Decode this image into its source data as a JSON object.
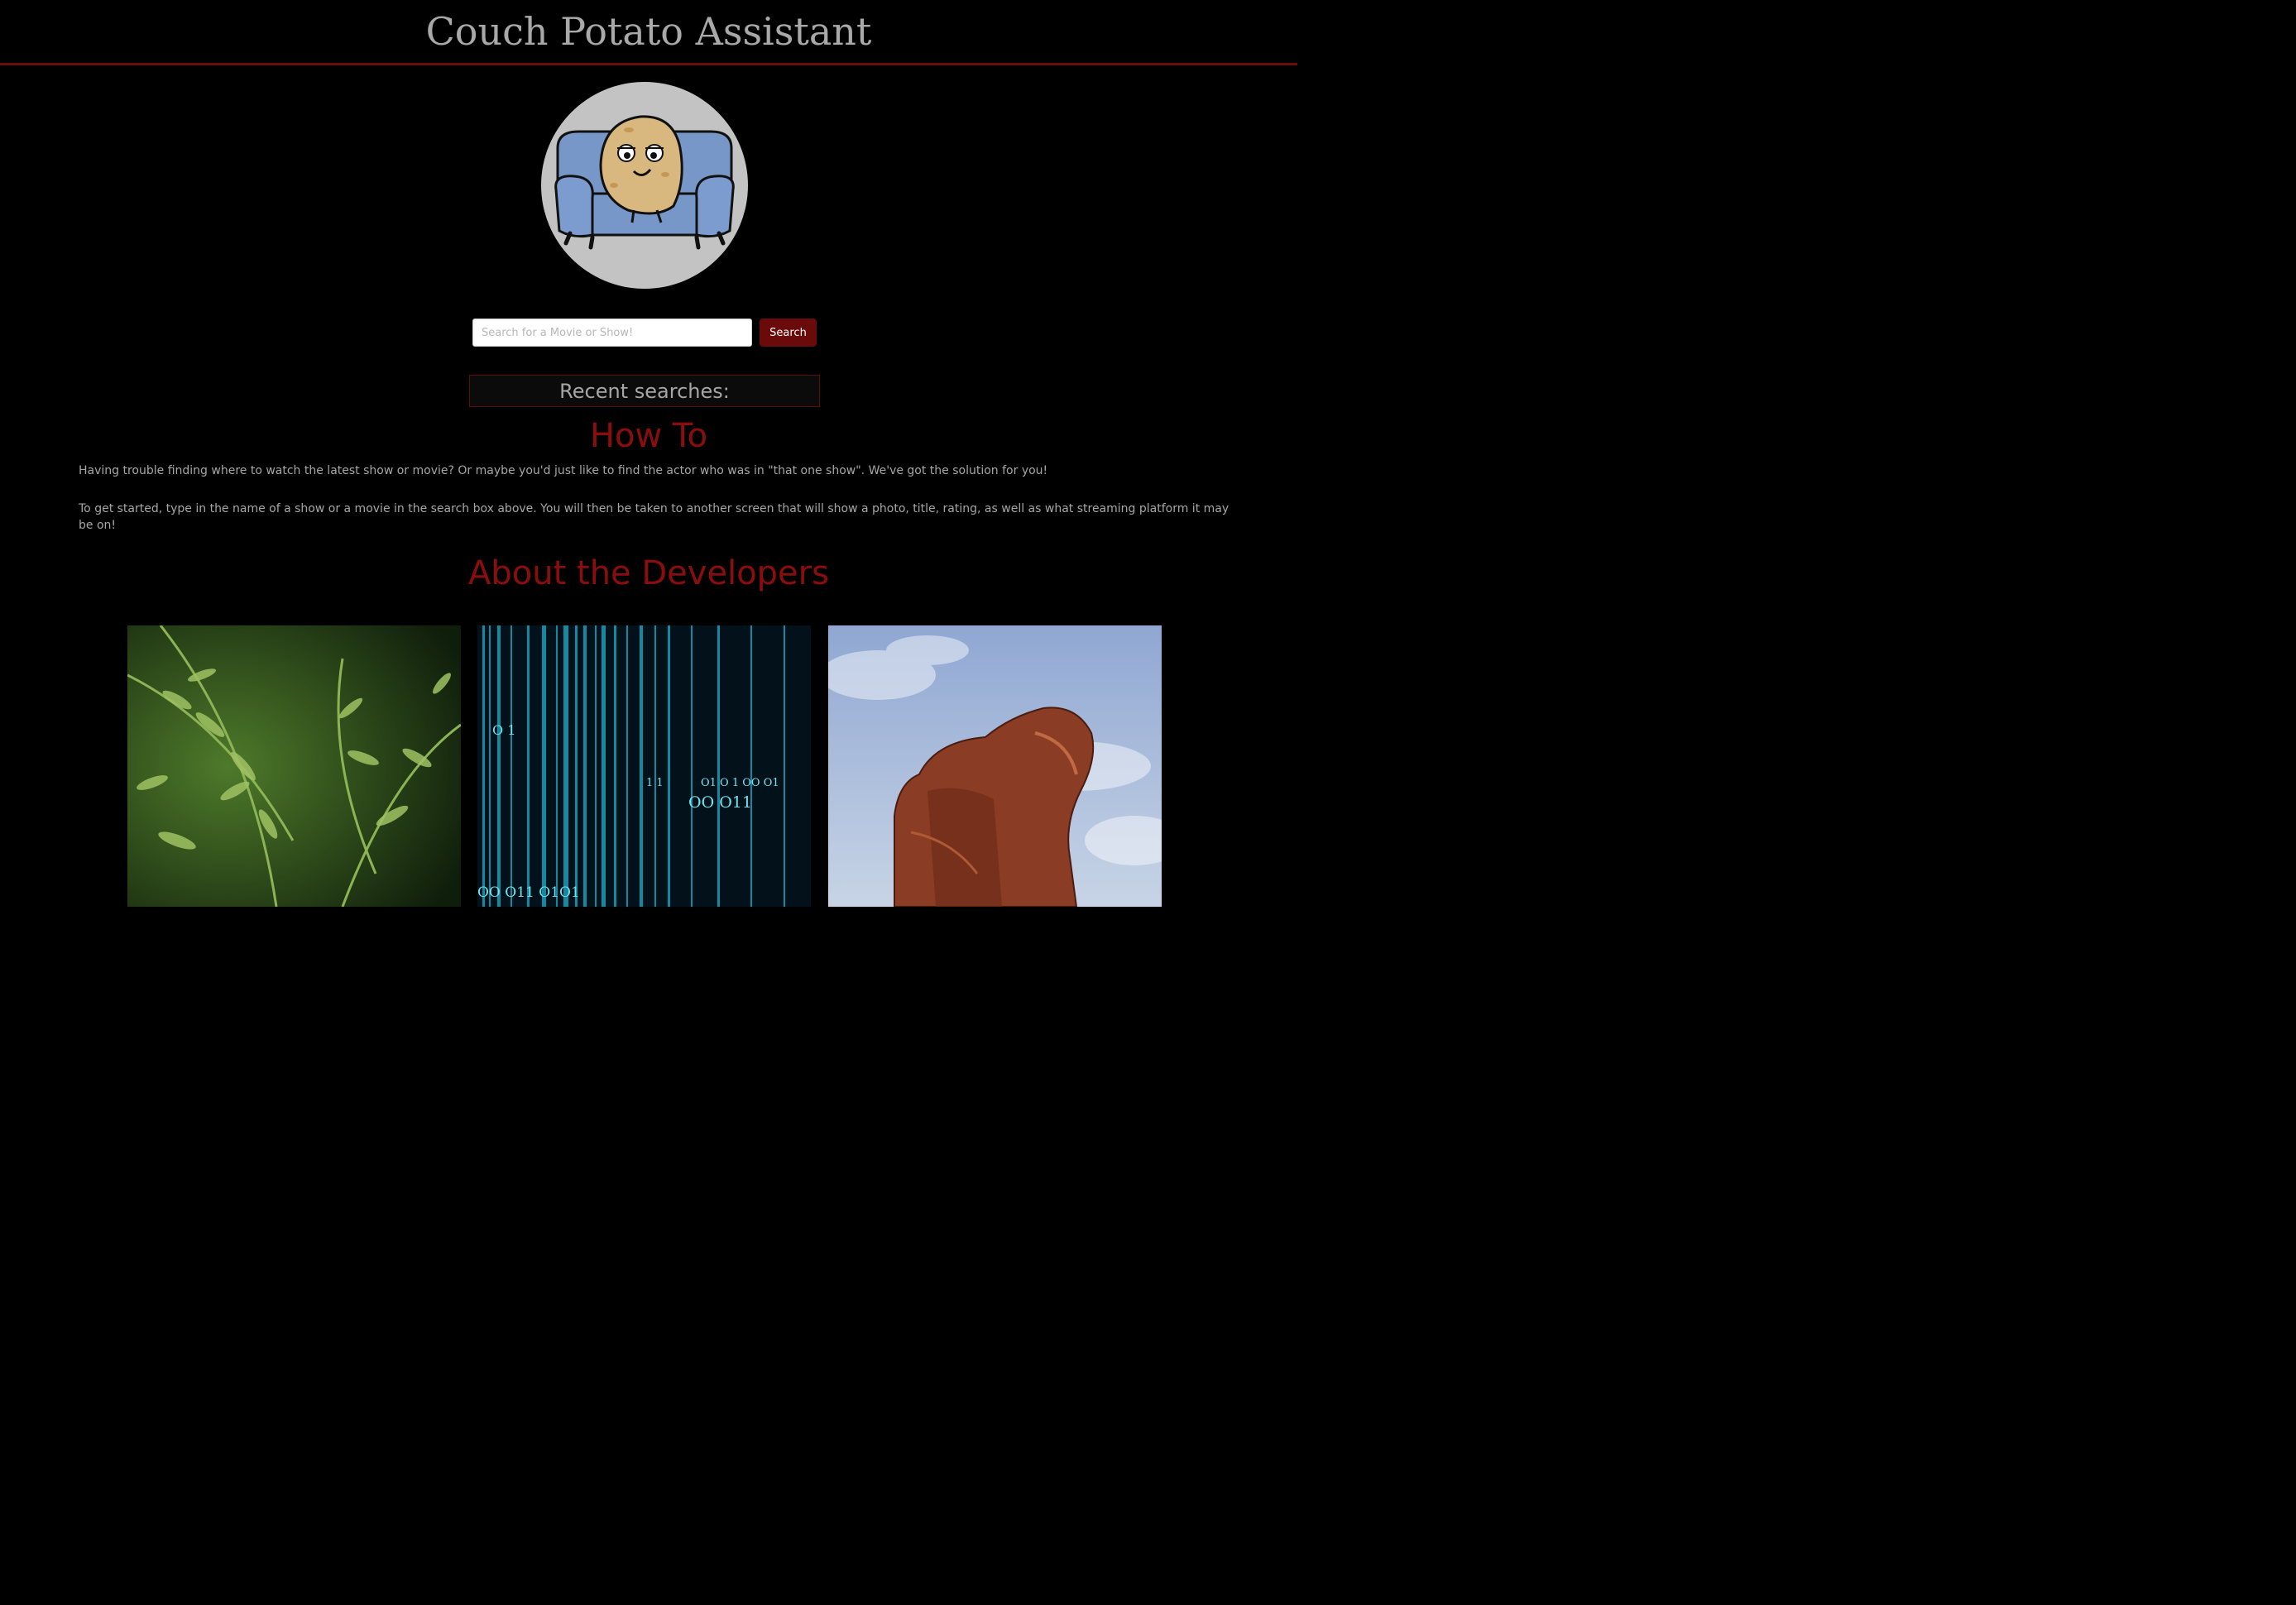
{
  "header": {
    "title": "Couch Potato Assistant"
  },
  "search": {
    "placeholder": "Search for a Movie or Show!",
    "value": "",
    "button_label": "Search"
  },
  "recent": {
    "label": "Recent searches:"
  },
  "how_to": {
    "heading": "How To",
    "paragraph_1": "Having trouble finding where to watch the latest show or movie? Or maybe you'd just like to find the actor who was in \"that one show\". We've got the solution for you!",
    "paragraph_2": "To get started, type in the name of a show or a movie in the search box above. You will then be taken to another screen that will show a photo, title, rating, as well as what streaming platform it may be on!"
  },
  "about": {
    "heading": "About the Developers"
  },
  "colors": {
    "accent": "#6b0e0e",
    "heading_red": "#8b0d0d",
    "background": "#000000"
  }
}
